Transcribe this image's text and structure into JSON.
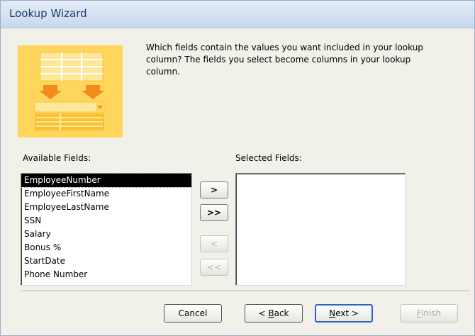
{
  "window": {
    "title": "Lookup Wizard"
  },
  "instruction": "Which fields contain the values you want included in your lookup column? The fields you select become columns in your lookup column.",
  "available": {
    "label": "Available Fields:",
    "items": [
      "EmployeeNumber",
      "EmployeeFirstName",
      "EmployeeLastName",
      "SSN",
      "Salary",
      "Bonus %",
      "StartDate",
      "Phone Number"
    ],
    "selected_index": 0
  },
  "selected": {
    "label": "Selected Fields:",
    "items": []
  },
  "move_buttons": {
    "add_one": ">",
    "add_all": ">>",
    "remove_one": "<",
    "remove_all": "<<"
  },
  "footer": {
    "cancel": "Cancel",
    "back_prefix": "< ",
    "back_mnemonic": "B",
    "back_rest": "ack",
    "next_mnemonic": "N",
    "next_rest": "ext >",
    "finish_mnemonic": "F",
    "finish_rest": "inish"
  },
  "colors": {
    "accent": "#2c63c9",
    "graphic": "#ffd65c",
    "dialog_bg": "#f1f0e9"
  }
}
